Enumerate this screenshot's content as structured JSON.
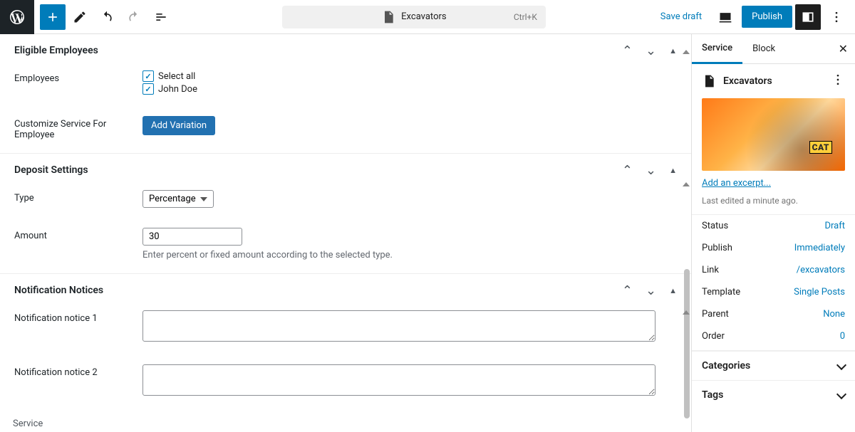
{
  "topbar": {
    "doc_title": "Excavators",
    "shortcut": "Ctrl+K",
    "save_draft": "Save draft",
    "publish": "Publish"
  },
  "sections": {
    "eligible": {
      "title": "Eligible Employees",
      "employees_label": "Employees",
      "select_all": "Select all",
      "employee_1": "John Doe",
      "customize_label": "Customize Service For Employee",
      "add_variation": "Add Variation"
    },
    "deposit": {
      "title": "Deposit Settings",
      "type_label": "Type",
      "type_value": "Percentage",
      "amount_label": "Amount",
      "amount_value": "30",
      "amount_help": "Enter percent or fixed amount according to the selected type."
    },
    "notify": {
      "title": "Notification Notices",
      "n1_label": "Notification notice 1",
      "n2_label": "Notification notice 2"
    }
  },
  "footer_tab": "Service",
  "sidebar": {
    "tab_service": "Service",
    "tab_block": "Block",
    "post_title": "Excavators",
    "image_badge": "CAT",
    "excerpt_link": "Add an excerpt...",
    "last_edited": "Last edited a minute ago.",
    "rows": {
      "status_l": "Status",
      "status_v": "Draft",
      "publish_l": "Publish",
      "publish_v": "Immediately",
      "link_l": "Link",
      "link_v": "/excavators",
      "template_l": "Template",
      "template_v": "Single Posts",
      "parent_l": "Parent",
      "parent_v": "None",
      "order_l": "Order",
      "order_v": "0"
    },
    "panel_categories": "Categories",
    "panel_tags": "Tags"
  }
}
